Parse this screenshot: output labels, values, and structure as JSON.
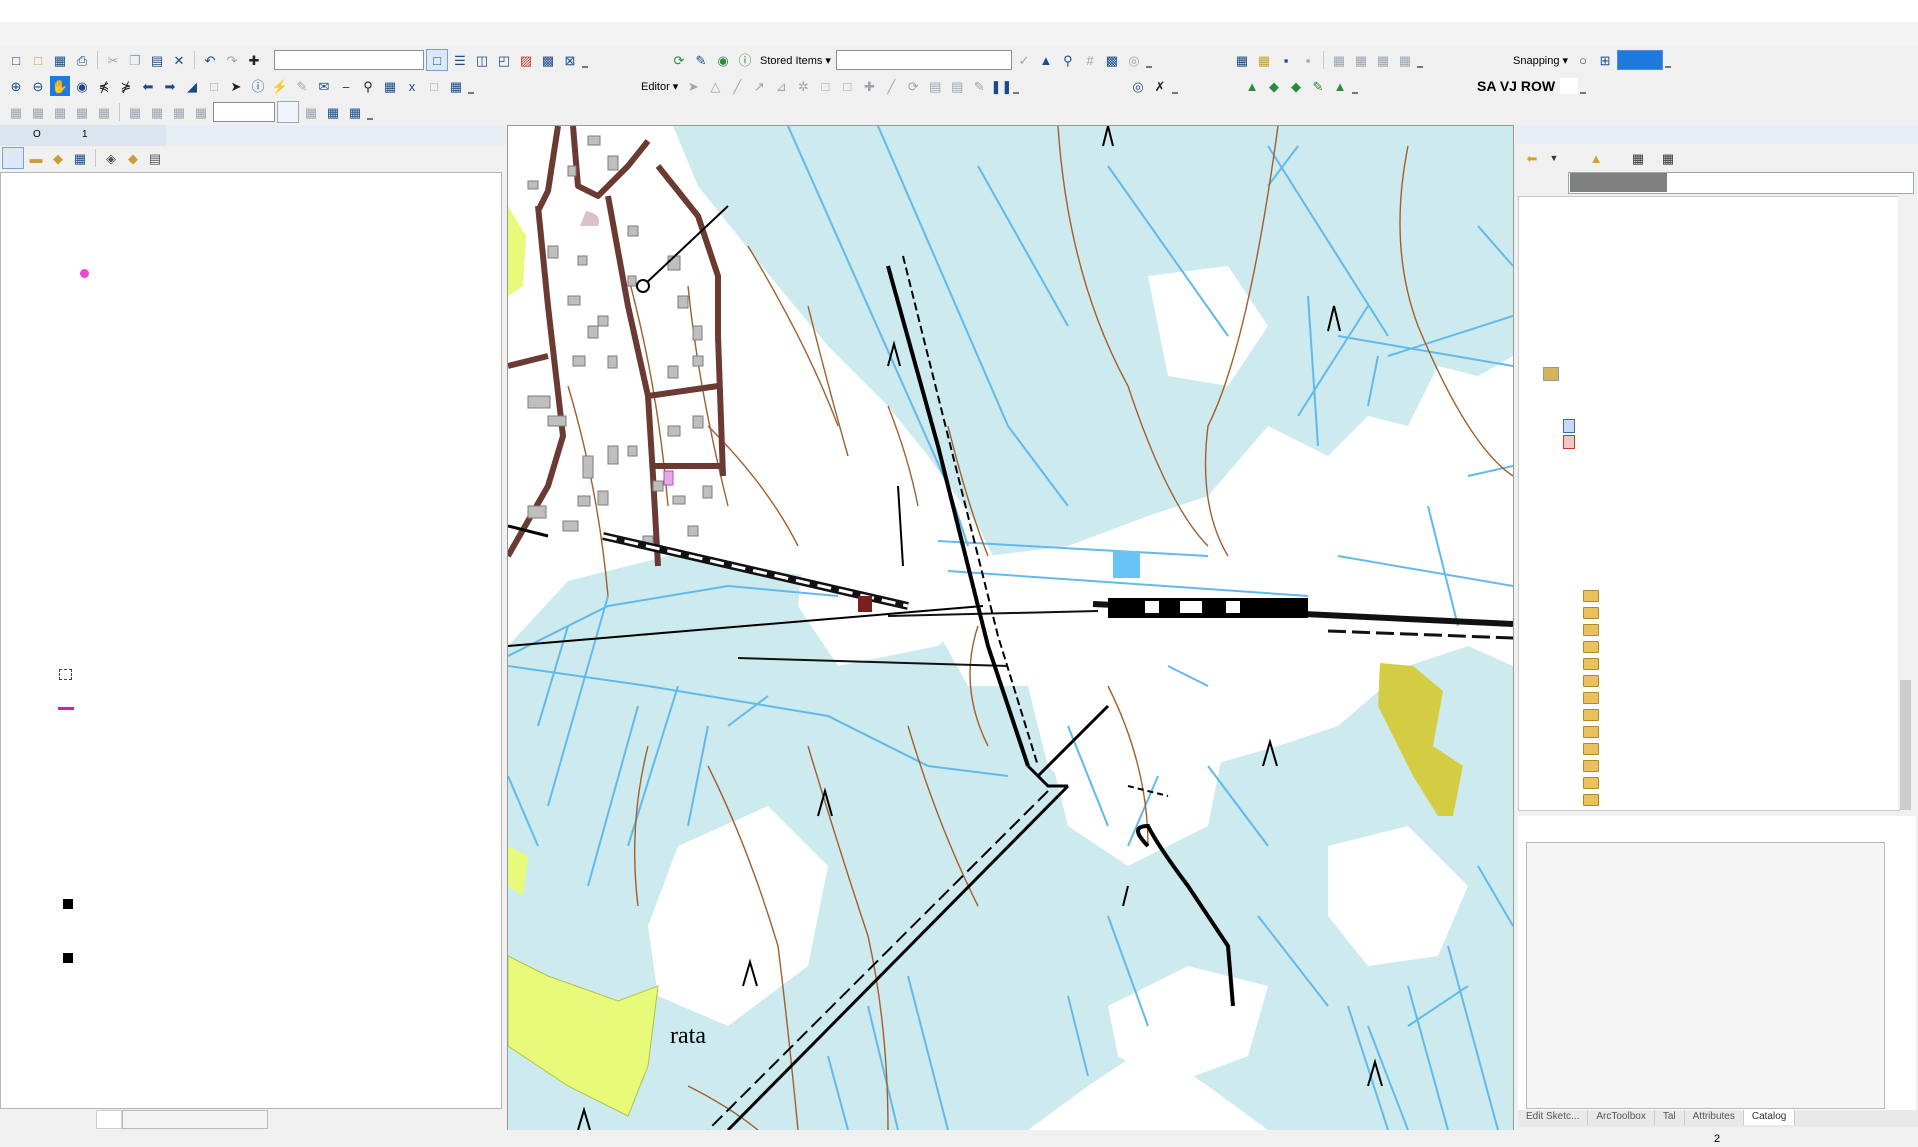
{
  "menubar": {
    "items": [
      "",
      "",
      "",
      "",
      "",
      "",
      "",
      "",
      "",
      "",
      ""
    ]
  },
  "toolbar_standard": {
    "scale_value": "",
    "add_data_icon": "add-data-icon"
  },
  "toolbar_stored": {
    "stored_items_label": "Stored Items ▾",
    "stored_items_value": ""
  },
  "toolbar_editor": {
    "editor_label": "Editor ▾"
  },
  "toolbar_snapping": {
    "snapping_label": "Snapping ▾"
  },
  "toolbar_labels": {
    "text": "SA VJ ROW"
  },
  "toc": {
    "tab_label": "O",
    "tab_label_2": "1",
    "symbols": [
      {
        "type": "point",
        "color": "#e94bd8"
      },
      {
        "type": "dashed-rect",
        "color": "#444444"
      },
      {
        "type": "line",
        "color": "#d61fa0"
      },
      {
        "type": "square",
        "color": "#000000"
      },
      {
        "type": "square",
        "color": "#000000"
      }
    ]
  },
  "map": {
    "label": "rata",
    "colors": {
      "wetland": "#cdeaee",
      "water_line": "#62b9ec",
      "contour": "#a0602d",
      "road": "#6b3a33",
      "field": "#e8fa7a",
      "olive": "#d4cd44"
    }
  },
  "catalog": {
    "location_value": "",
    "folder_count": 13
  },
  "bottom_tabs": [
    "Edit Sketc...",
    "ArcToolbox",
    "Tal",
    "Attributes",
    "Catalog"
  ],
  "status": {
    "page": "2"
  }
}
